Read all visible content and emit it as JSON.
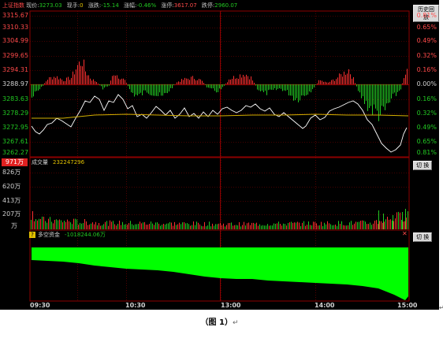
{
  "header": {
    "title": "上证指数",
    "price_label": "现价:",
    "price": "3273.03",
    "vol_label": "现手:",
    "vol": "0",
    "change_label": "涨跌:",
    "change": "-15.14",
    "pct_label": "涨幅:",
    "pct": "-0.46%",
    "limit_up_label": "涨停:",
    "limit_up": "3617.07",
    "limit_down_label": "跌停:",
    "limit_down": "2960.07"
  },
  "buttons": {
    "top": "历史回放",
    "volume": "切 换",
    "duokong": "切 换"
  },
  "price_axis": {
    "left": [
      "3315.67",
      "3310.33",
      "3304.99",
      "3299.65",
      "3294.31",
      "3288.97",
      "3283.63",
      "3278.29",
      "3272.95",
      "3267.61",
      "3262.27"
    ],
    "right": [
      "0.81%",
      "0.65%",
      "0.49%",
      "0.32%",
      "0.16%",
      "0.00%",
      "0.16%",
      "0.32%",
      "0.49%",
      "0.65%",
      "0.81%"
    ]
  },
  "volume_panel": {
    "badge": "971万",
    "label": "成交量",
    "value": "232247296",
    "axis": [
      "826万",
      "620万",
      "413万",
      "207万",
      "万"
    ]
  },
  "duokong_panel": {
    "q": "?",
    "label": "多空资金",
    "value": "-1018244.06万",
    "close": "✕"
  },
  "time_axis": [
    "09:30",
    "10:30",
    "13:00",
    "14:00",
    "15:00"
  ],
  "caption": "（图 1）",
  "caption_mark": "↵",
  "side_mark": "↵",
  "colors": {
    "up": "#ff3030",
    "down": "#22c822",
    "price_line": "#ffffff",
    "avg_line": "#d4b000",
    "fund_fill": "#00ff00",
    "grid": "#8b0000",
    "background": "#000000"
  }
}
